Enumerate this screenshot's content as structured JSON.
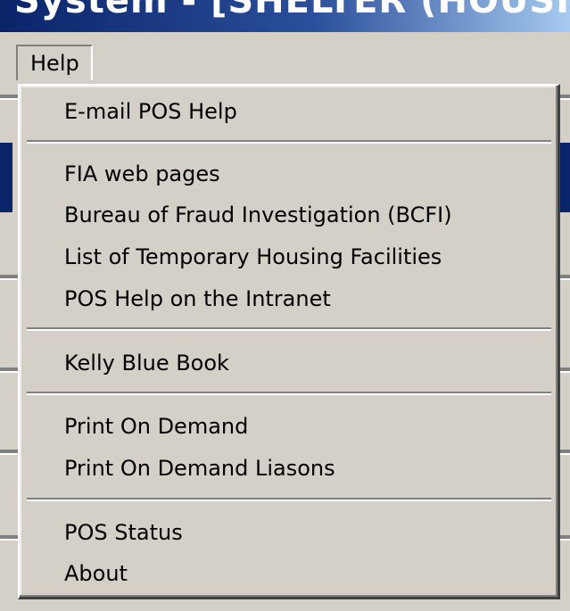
{
  "window": {
    "title": "System - [SHELTER (HOUSING"
  },
  "menubar": {
    "help_label": "Help"
  },
  "help_menu": {
    "items": [
      {
        "label": "E-mail POS Help"
      },
      {
        "label": "FIA web pages"
      },
      {
        "label": "Bureau of Fraud Investigation (BCFI)"
      },
      {
        "label": "List of Temporary Housing Facilities"
      },
      {
        "label": "POS Help on the Intranet"
      },
      {
        "label": "Kelly Blue Book"
      },
      {
        "label": "Print On Demand"
      },
      {
        "label": "Print On Demand Liasons"
      },
      {
        "label": "POS Status"
      },
      {
        "label": "About"
      }
    ]
  },
  "colors": {
    "menu_face": "#d4d0c8",
    "titlebar_active": "#0a246a",
    "shadow": "#808080",
    "highlight": "#ffffff"
  }
}
